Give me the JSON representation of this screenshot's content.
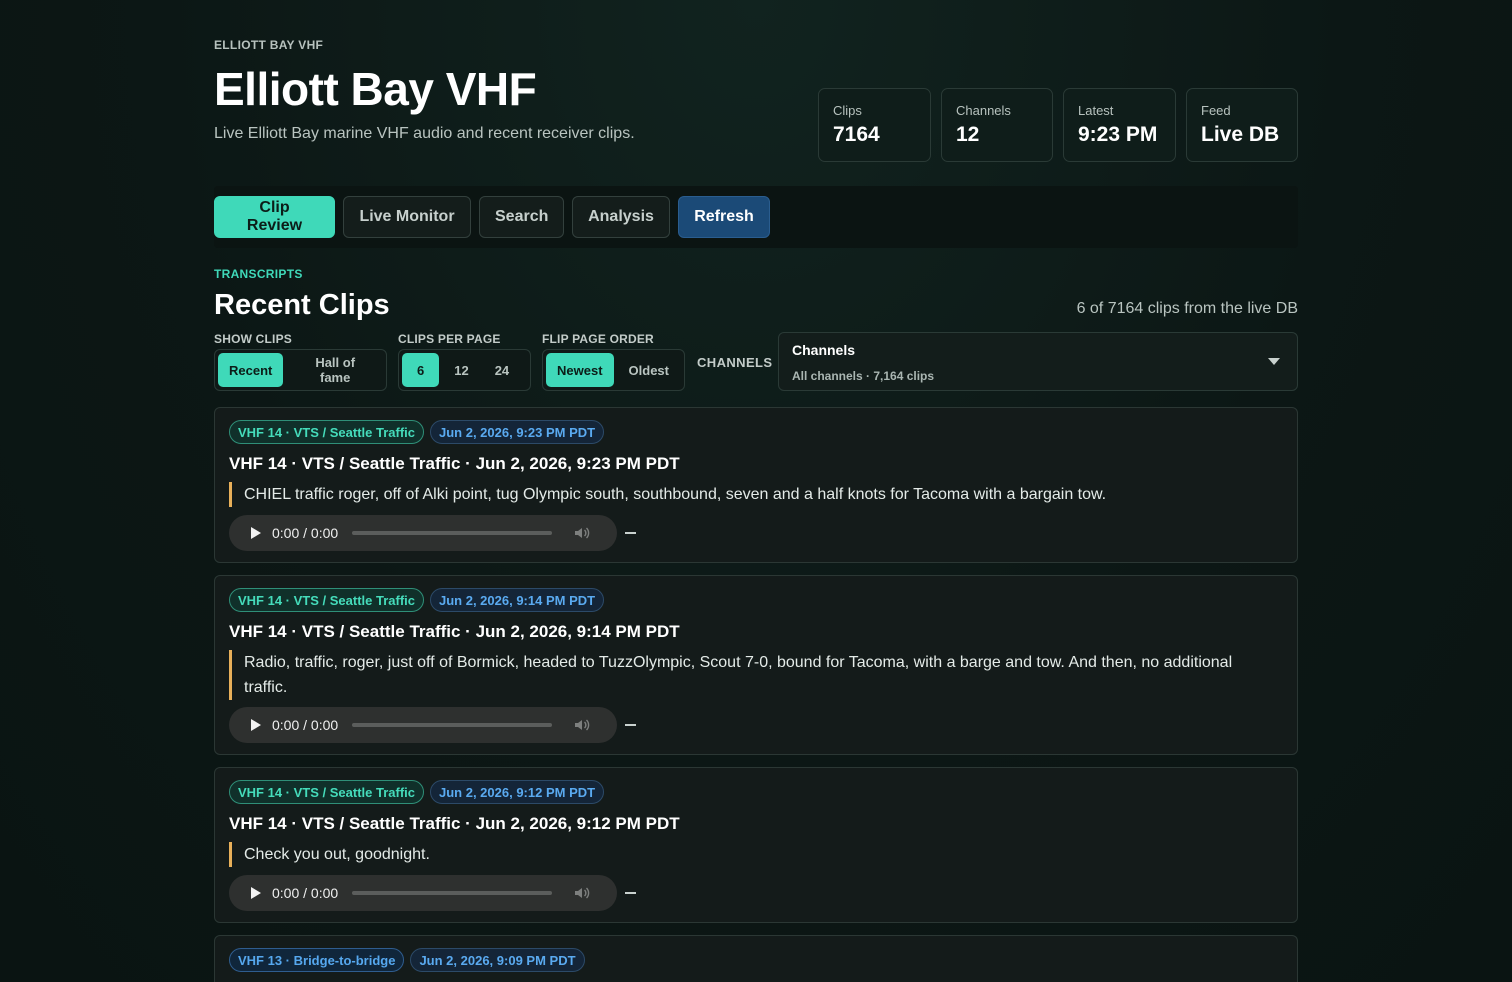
{
  "header": {
    "eyebrow": "ELLIOTT BAY VHF",
    "title": "Elliott Bay VHF",
    "subtitle": "Live Elliott Bay marine VHF audio and recent receiver clips."
  },
  "stats": [
    {
      "label": "Clips",
      "value": "7164"
    },
    {
      "label": "Channels",
      "value": "12"
    },
    {
      "label": "Latest",
      "value": "9:23 PM"
    },
    {
      "label": "Feed",
      "value": "Live DB"
    }
  ],
  "tabs": {
    "clip_review": "Clip Review",
    "live_monitor": "Live Monitor",
    "search": "Search",
    "analysis": "Analysis",
    "refresh": "Refresh"
  },
  "section": {
    "eyebrow": "TRANSCRIPTS",
    "title": "Recent Clips",
    "count": "6 of 7164 clips from the live DB"
  },
  "controls": {
    "show_clips": {
      "label": "SHOW CLIPS",
      "options": [
        "Recent",
        "Hall of fame"
      ],
      "selected": "Recent"
    },
    "per_page": {
      "label": "CLIPS PER PAGE",
      "options": [
        "6",
        "12",
        "24"
      ],
      "selected": "6"
    },
    "order": {
      "label": "FLIP PAGE ORDER",
      "options": [
        "Newest",
        "Oldest"
      ],
      "selected": "Newest"
    },
    "channels": {
      "label": "CHANNELS",
      "title": "Channels",
      "summary": "All channels · 7,164 clips"
    }
  },
  "clips": [
    {
      "channel": "VHF 14 · VTS / Seattle Traffic",
      "timestamp": "Jun 2, 2026, 9:23 PM PDT",
      "title": "VHF 14 · VTS / Seattle Traffic · Jun 2, 2026, 9:23 PM PDT",
      "transcript": "CHIEL traffic roger, off of Alki point, tug Olympic south, southbound, seven and a half knots for Tacoma with a bargain tow.",
      "time": "0:00 / 0:00"
    },
    {
      "channel": "VHF 14 · VTS / Seattle Traffic",
      "timestamp": "Jun 2, 2026, 9:14 PM PDT",
      "title": "VHF 14 · VTS / Seattle Traffic · Jun 2, 2026, 9:14 PM PDT",
      "transcript": "Radio, traffic, roger, just off of Bormick, headed to TuzzOlympic, Scout 7-0, bound for Tacoma, with a barge and tow. And then, no additional traffic.",
      "time": "0:00 / 0:00"
    },
    {
      "channel": "VHF 14 · VTS / Seattle Traffic",
      "timestamp": "Jun 2, 2026, 9:12 PM PDT",
      "title": "VHF 14 · VTS / Seattle Traffic · Jun 2, 2026, 9:12 PM PDT",
      "transcript": "Check you out, goodnight.",
      "time": "0:00 / 0:00"
    },
    {
      "channel": "VHF 13 · Bridge-to-bridge",
      "timestamp": "Jun 2, 2026, 9:09 PM PDT"
    }
  ],
  "colors": {
    "accent": "#3fd9b9",
    "refresh": "#1b4a77",
    "transcript_bar": "#e8b05a",
    "timestamp": "#5aaaf0"
  }
}
